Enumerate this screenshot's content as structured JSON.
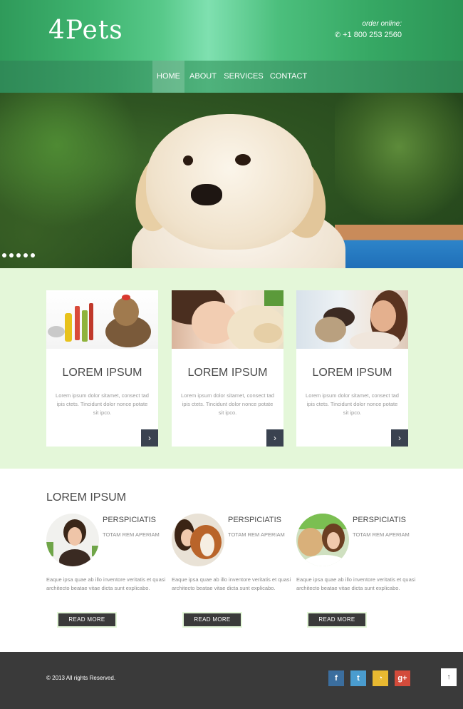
{
  "header": {
    "logo": "4Pets",
    "order_label": "order online:",
    "phone": "+1 800 253 2560",
    "phone_icon": "phone-icon"
  },
  "nav": {
    "items": [
      {
        "label": "HOME",
        "active": true
      },
      {
        "label": "ABOUT",
        "active": false
      },
      {
        "label": "SERVICES",
        "active": false
      },
      {
        "label": "CONTACT",
        "active": false
      }
    ]
  },
  "slider": {
    "slide_count": 5,
    "current": 1
  },
  "features": {
    "cards": [
      {
        "title": "LOREM IPSUM",
        "text": "Lorem ipsum dolor sitamet, consect tad ipis ctets. Tincidunt dolor nonce potate sit ipco.",
        "arrow": "›"
      },
      {
        "title": "LOREM IPSUM",
        "text": "Lorem ipsum dolor sitamet, consect tad ipis ctets. Tincidunt dolor nonce potate sit ipco.",
        "arrow": "›"
      },
      {
        "title": "LOREM IPSUM",
        "text": "Lorem ipsum dolor sitamet, consect tad ipis ctets. Tincidunt dolor nonce potate sit ipco.",
        "arrow": "›"
      }
    ]
  },
  "team": {
    "title": "LOREM IPSUM",
    "people": [
      {
        "name": "PERSPICIATIS",
        "subtitle": "TOTAM REM APERIAM",
        "text": "Eaque ipsa quae ab illo inventore veritatis et quasi architecto beatae vitae dicta sunt explicabo.",
        "button": "READ MORE"
      },
      {
        "name": "PERSPICIATIS",
        "subtitle": "TOTAM REM APERIAM",
        "text": "Eaque ipsa quae ab illo inventore veritatis et quasi architecto beatae vitae dicta sunt explicabo.",
        "button": "READ MORE"
      },
      {
        "name": "PERSPICIATIS",
        "subtitle": "TOTAM REM APERIAM",
        "text": "Eaque ipsa quae ab illo inventore veritatis et quasi architecto beatae vitae dicta sunt explicabo.",
        "button": "READ MORE"
      }
    ]
  },
  "footer": {
    "copyright": "© 2013 All rights Reserved.",
    "social": [
      {
        "icon": "facebook-icon",
        "glyph": "f",
        "color": "#3b6e9e"
      },
      {
        "icon": "twitter-icon",
        "glyph": "t",
        "color": "#4a9ccf"
      },
      {
        "icon": "rss-icon",
        "glyph": "◔",
        "color": "#e8b931"
      },
      {
        "icon": "google-plus-icon",
        "glyph": "g+",
        "color": "#d34b3b"
      }
    ],
    "to_top": "↑"
  },
  "colors": {
    "header_green": "#3fb470",
    "nav_green": "#3a9d66",
    "band_bg": "#e4f7d9",
    "dark": "#3a3a3a",
    "arrow_bg": "#3a4250"
  }
}
